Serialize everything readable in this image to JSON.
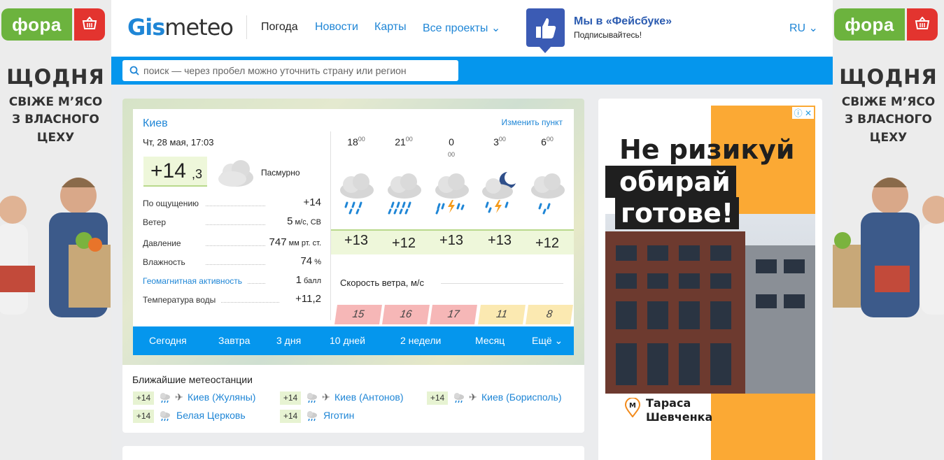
{
  "ads": {
    "left": {
      "brand": "фора",
      "line1": "ЩОДНЯ",
      "line2": "СВІЖЕ М’ЯСО",
      "line3": "З ВЛАСНОГО",
      "line4": "ЦЕХУ"
    },
    "right": {
      "brand": "фора",
      "line1": "ЩОДНЯ",
      "line2": "СВІЖЕ М’ЯСО",
      "line3": "З ВЛАСНОГО",
      "line4": "ЦЕХУ"
    },
    "banner": {
      "line1": "Не ризикуй –",
      "line2": "обирай",
      "line3": "готове!",
      "metro_line1": "Тараса",
      "metro_line2": "Шевченка"
    }
  },
  "header": {
    "logo_part1": "Gis",
    "logo_part2": "meteo",
    "nav": [
      "Погода",
      "Новости",
      "Карты",
      "Все проекты ⌄"
    ],
    "fb_title": "Мы в «Фейсбуке»",
    "fb_sub": "Подписывайтесь!",
    "lang": "RU ⌄"
  },
  "search": {
    "placeholder": "поиск — через пробел можно уточнить страну или регион"
  },
  "weather": {
    "city": "Киев",
    "change_link": "Изменить пункт",
    "date": "Чт, 28 мая, 17:03",
    "temp_main": "+14",
    "temp_frac": ",3",
    "condition": "Пасмурно",
    "params": [
      {
        "label": "По ощущению",
        "value": "+14",
        "unit": ""
      },
      {
        "label": "Ветер",
        "value": "5",
        "unit": " м/с, СВ"
      },
      {
        "label": "Давление",
        "value": "747",
        "unit": " мм рт. ст."
      },
      {
        "label": "Влажность",
        "value": "74",
        "unit": " %"
      },
      {
        "label": "Геомагнитная активность",
        "value": "1",
        "unit": " балл"
      },
      {
        "label": "Температура воды",
        "value": "+11,2",
        "unit": ""
      }
    ],
    "hours": [
      {
        "h": "18",
        "m": "00",
        "sub": "",
        "temp": "+13",
        "wind": "15"
      },
      {
        "h": "21",
        "m": "00",
        "sub": "",
        "temp": "+12",
        "wind": "16"
      },
      {
        "h": "0",
        "m": "",
        "sub": "00",
        "temp": "+13",
        "wind": "17"
      },
      {
        "h": "3",
        "m": "00",
        "sub": "",
        "temp": "+13",
        "wind": "11"
      },
      {
        "h": "6",
        "m": "00",
        "sub": "",
        "temp": "+12",
        "wind": "8"
      }
    ],
    "wind_title": "Скорость ветра, м/с",
    "tabs": [
      "Сегодня",
      "Завтра",
      "3 дня",
      "10 дней",
      "2 недели",
      "Месяц",
      "Ещё ⌄"
    ],
    "stations_title": "Ближайшие метеостанции",
    "stations": [
      {
        "temp": "+14",
        "name": "Киев (Жуляны)",
        "airport": true
      },
      {
        "temp": "+14",
        "name": "Киев (Антонов)",
        "airport": true
      },
      {
        "temp": "+14",
        "name": "Киев (Борисполь)",
        "airport": true
      },
      {
        "temp": "+14",
        "name": "Белая Церковь",
        "airport": false
      },
      {
        "temp": "+14",
        "name": "Яготин",
        "airport": false
      }
    ]
  },
  "colors": {
    "accent": "#0596ed",
    "link": "#1f86d6",
    "green_bg": "#eef7da",
    "wind_red": "#f6b7b7",
    "wind_yellow": "#fbe9b1",
    "fora_green": "#6cb33e",
    "fora_red": "#e3342f",
    "banner_orange": "#fba934"
  }
}
